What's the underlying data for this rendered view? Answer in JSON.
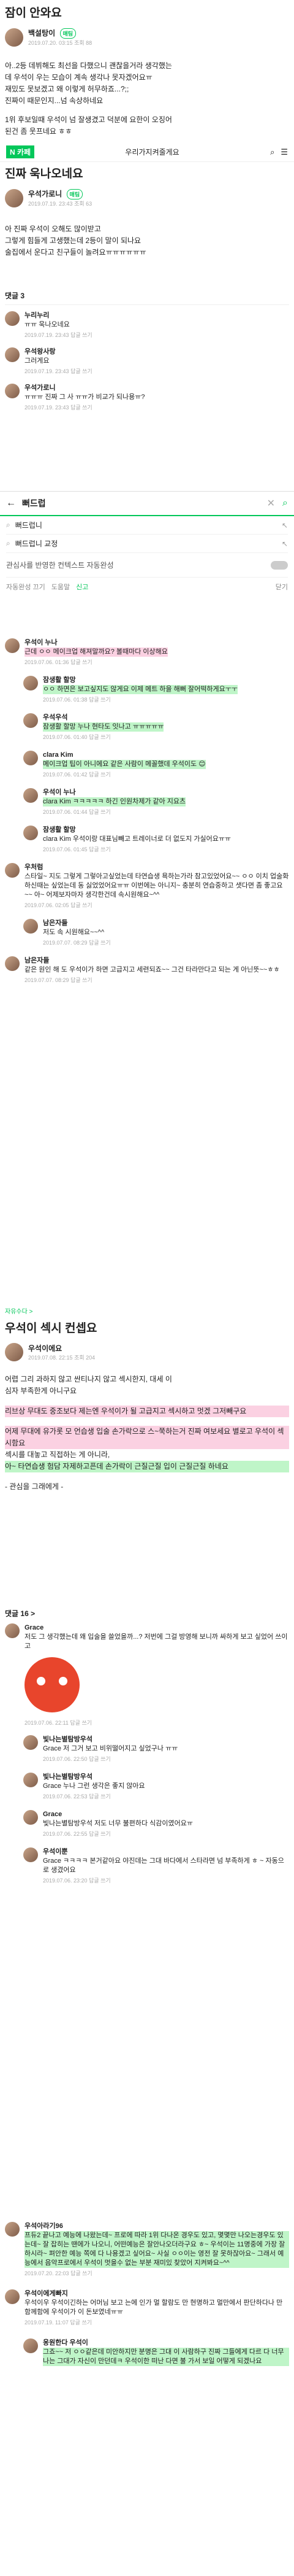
{
  "post": {
    "title": "잠이 안와요",
    "author": "백설탕이",
    "author_badge": "매팀",
    "date": "2019.07.20. 03:15",
    "views": "조회 88",
    "body": [
      "아..2등 데뷔해도 최선을 다했으니 괜찮을거라 생각했는",
      "데 우석이 우는 모습이 계속 생각나 못자겠어요ㅠ",
      "재밌도 못보겠고 왜 이렇게 허무하죠...?;;",
      "진짜이 때문인지...넘 속상하네요",
      "",
      "1위 후보일때 우석이 넘 잘생겼고 덕분에 요한이 오징어",
      "된건 좀 웃프네요 ㅎㅎ"
    ]
  },
  "cafe_header": {
    "brand": "N 카페",
    "cafe_name": "우리가지켜줄게요"
  },
  "post2": {
    "title": "진짜 욱나오네요",
    "author": "우석가로니",
    "author_badge": "매팀",
    "date": "2019.07.19. 23:43",
    "views": "조회 63",
    "body": [
      "아 진짜 우석이 오해도 많이받고",
      "그렇게 힘들게 고생했는데 2등이 말이 되나요",
      "술집에서 운다고 친구들이 놀려요ㅠㅠㅠㅠㅠㅠ"
    ],
    "comments_label": "댓글 3",
    "comments": [
      {
        "name": "누리누리",
        "text": "ㅠㅠ 욱나오네요",
        "meta": "2019.07.19. 23:43  답글 쓰기"
      },
      {
        "name": "우석왕사랑",
        "text": "그러게요",
        "meta": "2019.07.19. 23:43  답글 쓰기"
      },
      {
        "name": "우석가로니",
        "text": "ㅠㅠㅠ 진짜 그 사 ㅠㅠ가 비교가 되나용ㅠ?",
        "meta": "2019.07.19. 23:43  답글 쓰기"
      }
    ]
  },
  "search": {
    "query": "뻐드럽",
    "suggestions": [
      "뻐드럽니",
      "뻐드럽니 교정"
    ],
    "toggle_label": "관심사를 반영한 컨텍스트 자동완성",
    "footer": [
      "자동완성 끄기",
      "도움말",
      "신고",
      "닫기"
    ]
  },
  "thread": [
    {
      "name": "우석이 누나",
      "text": "근데 ㅇㅇ 메이크업 해져말까요? 볼때마다 이상해요",
      "meta": "2019.07.06. 01:36  답글 쓰기",
      "reply": false,
      "hl": true
    },
    {
      "name": "잠생활 할망",
      "text": "ㅇㅇ 하면은 보고싶지도 않게요 이제 메트 하을 해뻐 잘어떡하게요ㅜㅜ",
      "meta": "2019.07.06. 01:38  답글 쓰기",
      "reply": true,
      "hl": true
    },
    {
      "name": "우석우석",
      "text": "잠생활 할망 누나 현타도 잇나고 ㅠㅠㅠㅠㅠ",
      "meta": "2019.07.06. 01:40  답글 쓰기",
      "reply": true,
      "hl": true
    },
    {
      "name": "clara Kim",
      "text": "메이크업 팁이 아니에요 같은 사람이 메꼴했데 우석이도 😊",
      "meta": "2019.07.06. 01:42  답글 쓰기",
      "reply": true,
      "hl": true
    },
    {
      "name": "우석이 누나",
      "text": "clara Kim ㅋㅋㅋㅋㅋ 하긴 인원차제가 같아 지요츠",
      "meta": "2019.07.06. 01:44  답글 쓰기",
      "reply": true,
      "hl": true
    },
    {
      "name": "잠생활 할망",
      "text": "clara Kim 우석이랑 대표님빼고 트레이너로 더 없도지 가실어요ㅠㅠ",
      "meta": "2019.07.06. 01:45  답글 쓰기",
      "reply": true,
      "hl": false
    },
    {
      "name": "우처럼",
      "text": "스타일~ 지도 그렇게 그렇아고싶었는데 타연습생 욕하는가라 참고있었어요~~ ㅇㅇ 이치 업술화하신때는 싶었는데 동 싫었었어요ㅠㅠ 이번에는 아니지~ 충분히 연습중하고 샛다면 좀 좋고요~~ 아~ 어제보자마자 생각한건데 속시원해요~^^",
      "meta": "2019.07.06. 02:05  답글 쓰기",
      "reply": false,
      "hl": false
    },
    {
      "name": "남은자들",
      "text": "저도 속 시원해요~~^^",
      "meta": "2019.07.07. 08:29  답글 쓰기",
      "reply": true,
      "hl": false
    },
    {
      "name": "남은자들",
      "text": "같은 원인 해 도 우석이가 하면 고급지고 세련되죠~~ 그건 타라만다고 되는 게 아닌뜻~~ㅎㅎ",
      "meta": "2019.07.07. 08:29  답글 쓰기",
      "reply": false,
      "hl": false
    }
  ],
  "post3": {
    "category": "자유수다 >",
    "title": "우석이 섹시 컨셉요",
    "author": "우석이에요",
    "date": "2019.07.08. 22:15",
    "views": "조회 204",
    "body": [
      "어렵 그리 과하지 않고 싼티나지 않고 섹시한지, 대세 이",
      "심자 부족한게 아니구요",
      "",
      "리브상 무대도 중조보다 제는엔 우석이가 될 고급지고 섹시하고 멋겠 그저빼구요",
      "",
      "어제 무대에 유가롯 모 언습생 입술 손가락으로 스~쭉하는거 진짜 여보세요 별로고 우석이 섹시함요",
      "섹시를 대놓고 직접하는 게 아니라,",
      "아~ 타연습생 험담 자제하고픈데 손가락이 근질근질 입이 근질근질 하네요",
      "",
      "- 관심을 그래에게 -"
    ],
    "comments_label": "댓글 16 >",
    "comments": [
      {
        "name": "Grace",
        "text": "저도 그 생각했는데 왜 입술을 쓸었을까...? 저번에 그걸 방영해 보니까 싸하게 보고 싶었어 쓰이고",
        "meta": "2019.07.06. 22:11  답글 쓰기",
        "reply": false
      },
      {
        "name": "빛나는별탐방우석",
        "text": "Grace 저 그거 보고 비위떨어지고 싶었구나 ㅠㅠ",
        "meta": "2019.07.06. 22:50  답글 쓰기",
        "reply": true
      },
      {
        "name": "빛나는별탐방우석",
        "text": "Grace 누나 그런 생각은 좋지 않아요",
        "meta": "2019.07.06. 22:53  답글 쓰기",
        "reply": true
      },
      {
        "name": "Grace",
        "text": "빛나는별탐방우석 저도 너무 불편하다 식감이였어요ㅠ",
        "meta": "2019.07.06. 22:55  답글 쓰기",
        "reply": true
      },
      {
        "name": "우석이뿐",
        "text": "Grace ㅋㅋㅋㅋ 본거같아요 야진데는 그대 바다에서 스타라면 넘 부족하게 ㅎ ~ 자동으로 생겼어요",
        "meta": "2019.07.06. 23:20  답글 쓰기",
        "reply": true
      }
    ]
  },
  "tail": [
    {
      "name": "우석아라기96",
      "text": "프듀2 끝나고 예능에 나왔는데~ 프로에 따라 1위 다나온 경우도 있고, 몇몇만 나오는경우도 있는데~ 잘 잡히는 땐에가 나오니, 어떤예능은 잘안나오더라구요 ㅎ~ 우석이는 11명중에 가장 잘하시라~ 펴안한 예능 쪽에 다 나용겠고 싶어요~ 사실 ㅇㅇ이는 영전 잘 못하잖아요~ 그래서 예능에서 음악프로에서 우석이 멋을수 없는 부분 재미있 찾았어 지켜봐요~^^",
      "meta": "2019.07.20. 22:03  답글 쓰기"
    },
    {
      "name": "우석이에게빠지",
      "text": "우석이우 우석이긴하는 어머님 보고 는에 인가 멀 할람도 만 현명하고 멀만에서 판단하다나 만 함께함에 우석이가 이 돈보였네ㅠㅠ",
      "meta": "2019.07.19. 11:07  답글 쓰기"
    },
    {
      "name": "웅원한다 우석이",
      "text": "그죠~~ 저 ㅇㅇ같은데 미안하지만 분명은 그대 이 사람하구 진짜 그들에게 다르 다 너무 나는 그대가 자신이 만던데ㅋ 우석이한 떠난 다면 불 가서 보일 어떻게 되겠나요",
      "meta": ""
    }
  ]
}
